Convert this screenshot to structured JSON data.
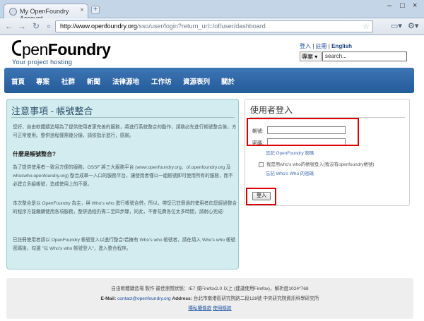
{
  "browser": {
    "tab_title": "My OpenFoundry Account",
    "tab_close": "×",
    "new_tab": "+",
    "url_host": "http://www.openfoundry.org",
    "url_path": "/sso/user/login?return_url=/of/user/dashboard",
    "win_minimize": "–",
    "win_maximize": "□",
    "win_close": "×"
  },
  "header": {
    "logo_open": "pen",
    "logo_foundry": "Foundry",
    "slogan": "Your project hosting",
    "login_link": "登入",
    "register_link": "註冊",
    "separator": "|",
    "english_link": "English",
    "search_select": "專案 ▾",
    "search_placeholder": "search..."
  },
  "nav": [
    "首頁",
    "專案",
    "社群",
    "新聞",
    "法律源地",
    "工作坊",
    "資源表列",
    "關於"
  ],
  "notice": {
    "title": "注意事項 - 帳號整合",
    "p1": "您好，自由軟體鑄造場為了提供使用者更完善的服務，將進行系統整合的動作，請務必先進行帳號整合後，方可正常使用。整併過程僅需幾分鐘，請依指示進行，感謝。",
    "subtitle": "什麼是帳號整合?",
    "p2": "為了提供使用者一致且方便的服務，OSSF 將三大服務平台 (www.openfoundry.org、of.openfoundry.org 及 whoswho.openfoundry.org) 整合成單一入口的服務平台，讓使用者僅以一組帳號即可使用所有的服務，而不必建立多組帳號，造成使用上的不便。",
    "p3": "本次整合是以 OpenFoundry 為主，與 Who's who 進行帳號合併。所以，帶您已註冊過的使用者向您經過整合的程序方能繼續使用各項服務，整併過程仍需二至四步驟，同此，不會花費各位太多時間，請耐心完成!",
    "p4": "已註冊使用者請以 OpenFoundry 帳號登入以進行整合!若擁有 Who's who 帳號者，請在填入 Who's who 帳號密碼後，勾選 \"以 Who's who 帳號登入\"，進入整合程序。"
  },
  "login": {
    "title": "使用者登入",
    "username_label": "帳號:",
    "password_label": "密碼:",
    "forgot_of": "忘記 OpenFoundry 密碼",
    "remember_label": "我是用who's who的帳號登入(我沒有openfoundry帳號)",
    "forgot_whoswho": "忘記 Who's Who 的密碼",
    "submit": "登入"
  },
  "footer": {
    "line1": "自由軟體鑄造場 製作 最佳瀏覽狀態：IE7 或Firefox2.0 以上 (建議使用Firefox)，解析度1024*768",
    "email_label": "E-Mail:",
    "email": "contact@openfoundry.org",
    "address_label": "Address:",
    "address": "台北市南港區研究院路二段128號 中央研究院資訊科學研究所",
    "privacy_link": "隱私權條款",
    "terms_link": "使用條款"
  },
  "colors": {
    "nav_bg": "#2d65a6",
    "notice_bg": "#d2ecef",
    "highlight": "#e00000"
  }
}
